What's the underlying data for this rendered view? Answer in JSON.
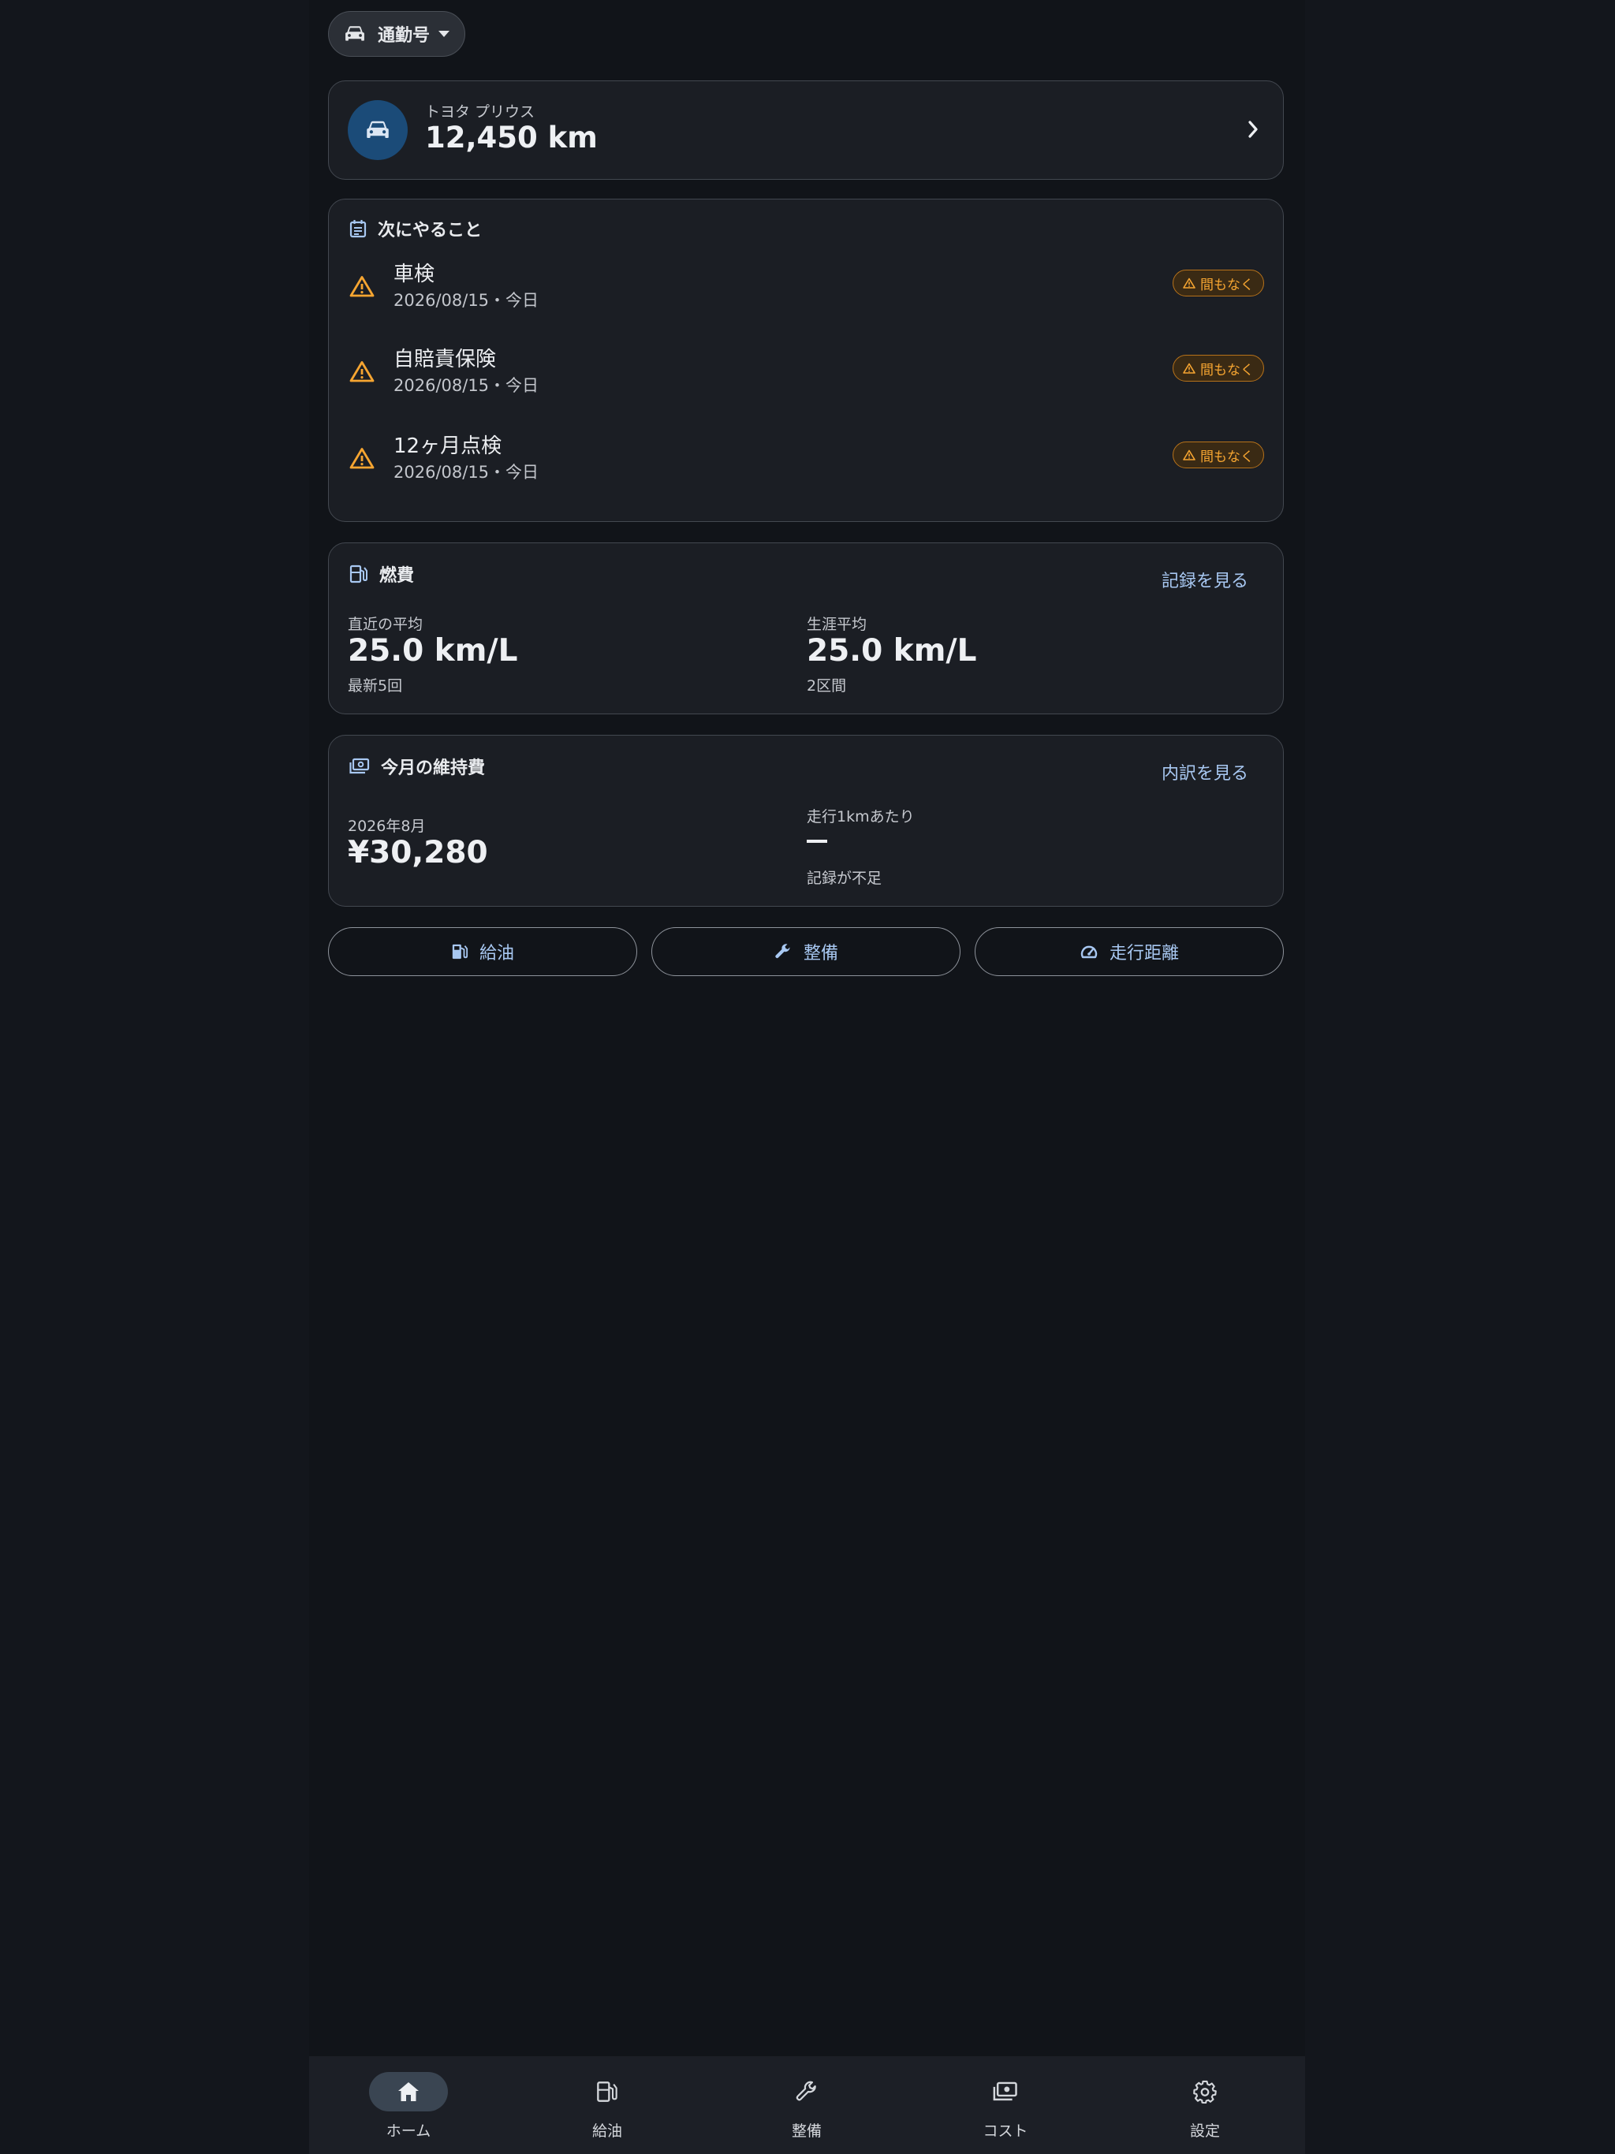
{
  "vehicle_selector": {
    "label": "通勤号",
    "icon": "car-icon",
    "caret": "dropdown-caret-icon"
  },
  "summary": {
    "model": "トヨタ プリウス",
    "odometer": "12,450 km",
    "icon": "car-icon"
  },
  "todo": {
    "title": "次にやること",
    "icon": "calendar-icon",
    "items": [
      {
        "name": "車検",
        "date": "2026/08/15・今日",
        "badge": "間もなく"
      },
      {
        "name": "自賠責保険",
        "date": "2026/08/15・今日",
        "badge": "間もなく"
      },
      {
        "name": "12ヶ月点検",
        "date": "2026/08/15・今日",
        "badge": "間もなく"
      }
    ],
    "warning_color": "#f6a531"
  },
  "fuel": {
    "title": "燃費",
    "icon": "fuel-icon",
    "link": "記録を見る",
    "recent": {
      "label": "直近の平均",
      "value": "25.0 km/L",
      "sub": "最新5回"
    },
    "lifetime": {
      "label": "生涯平均",
      "value": "25.0 km/L",
      "sub": "2区間"
    }
  },
  "cost": {
    "title": "今月の維持費",
    "icon": "money-icon",
    "link": "内訳を見る",
    "month": {
      "label": "2026年8月",
      "value": "¥30,280"
    },
    "per_km": {
      "label": "走行1kmあたり",
      "value": "—",
      "sub": "記録が不足"
    }
  },
  "actions": [
    {
      "label": "給油",
      "icon": "fuel-icon"
    },
    {
      "label": "整備",
      "icon": "wrench-icon"
    },
    {
      "label": "走行距離",
      "icon": "speedometer-icon"
    }
  ],
  "nav": [
    {
      "label": "ホーム",
      "icon": "home-icon",
      "active": true
    },
    {
      "label": "給油",
      "icon": "fuel-icon",
      "active": false
    },
    {
      "label": "整備",
      "icon": "wrench-icon",
      "active": false
    },
    {
      "label": "コスト",
      "icon": "money-icon",
      "active": false
    },
    {
      "label": "設定",
      "icon": "gear-icon",
      "active": false
    }
  ],
  "colors": {
    "background": "#111419",
    "card": "#1b1e24",
    "accent": "#a8c8f2",
    "avatar": "#1b4b78",
    "warning": "#f6a531"
  }
}
